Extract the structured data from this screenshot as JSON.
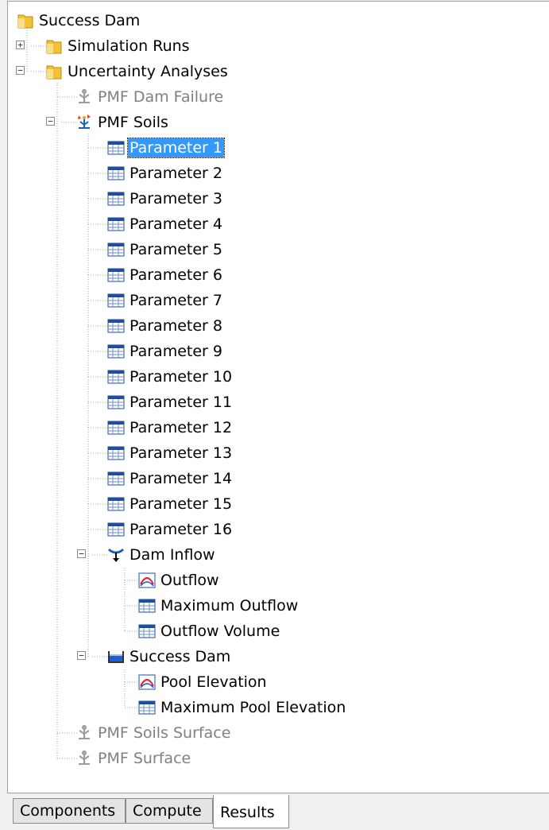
{
  "tree": {
    "root": {
      "label": "Success Dam",
      "icon": "folder-icon"
    },
    "simulation_runs": {
      "label": "Simulation Runs",
      "icon": "folder-icon",
      "expanded": false
    },
    "uncertainty_analyses": {
      "label": "Uncertainty Analyses",
      "icon": "folder-icon",
      "expanded": true
    },
    "pmf_dam_failure": {
      "label": "PMF Dam Failure",
      "icon": "analysis-icon",
      "disabled": true
    },
    "pmf_soils": {
      "label": "PMF Soils",
      "icon": "analysis-active-icon",
      "expanded": true
    },
    "parameters": [
      {
        "label": "Parameter 1",
        "selected": true
      },
      {
        "label": "Parameter 2"
      },
      {
        "label": "Parameter 3"
      },
      {
        "label": "Parameter 4"
      },
      {
        "label": "Parameter 5"
      },
      {
        "label": "Parameter 6"
      },
      {
        "label": "Parameter 7"
      },
      {
        "label": "Parameter 8"
      },
      {
        "label": "Parameter 9"
      },
      {
        "label": "Parameter 10"
      },
      {
        "label": "Parameter 11"
      },
      {
        "label": "Parameter 12"
      },
      {
        "label": "Parameter 13"
      },
      {
        "label": "Parameter 14"
      },
      {
        "label": "Parameter 15"
      },
      {
        "label": "Parameter 16"
      }
    ],
    "dam_inflow": {
      "label": "Dam Inflow",
      "icon": "junction-icon",
      "expanded": true,
      "children": [
        {
          "label": "Outflow",
          "icon": "graph-icon"
        },
        {
          "label": "Maximum Outflow",
          "icon": "table-icon"
        },
        {
          "label": "Outflow Volume",
          "icon": "table-icon"
        }
      ]
    },
    "success_dam": {
      "label": "Success Dam",
      "icon": "reservoir-icon",
      "expanded": true,
      "children": [
        {
          "label": "Pool Elevation",
          "icon": "graph-icon"
        },
        {
          "label": "Maximum Pool Elevation",
          "icon": "table-icon"
        }
      ]
    },
    "pmf_soils_surface": {
      "label": "PMF Soils Surface",
      "icon": "analysis-icon",
      "disabled": true
    },
    "pmf_surface": {
      "label": "PMF Surface",
      "icon": "analysis-icon",
      "disabled": true
    }
  },
  "tabs": [
    {
      "label": "Components",
      "active": false
    },
    {
      "label": "Compute",
      "active": false
    },
    {
      "label": "Results",
      "active": true
    }
  ],
  "colors": {
    "selection": "#3399ff",
    "disabled_text": "#808080",
    "folder": "#f2c230"
  }
}
